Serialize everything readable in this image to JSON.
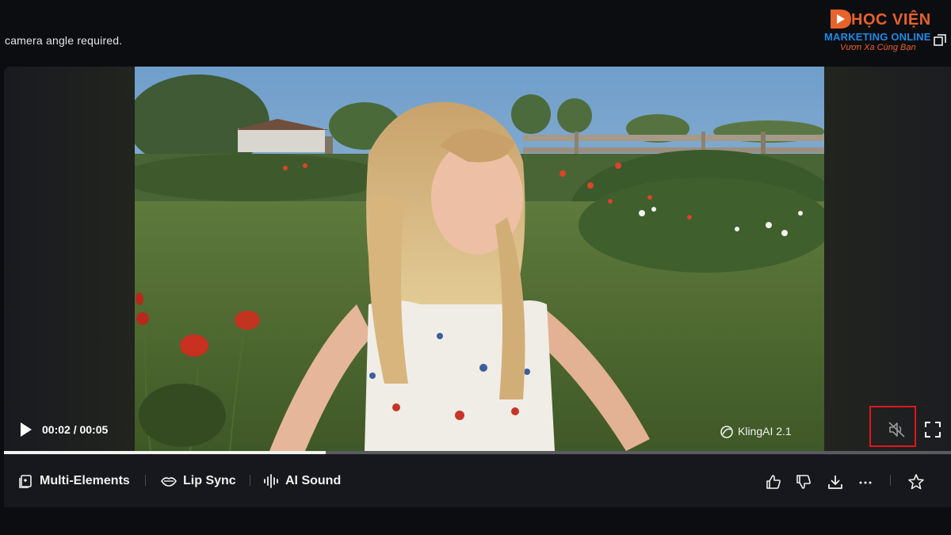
{
  "header": {
    "caption": "camera angle required."
  },
  "brand": {
    "line1": "HỌC VIỆN",
    "line2": "MARKETING ONLINE",
    "line3": "Vươn Xa Cùng Bạn",
    "color_primary": "#e8622c",
    "color_secondary": "#1f8be6"
  },
  "player": {
    "time_display": "00:02 / 00:05",
    "current": "00:02",
    "duration": "00:05",
    "progress_fraction": 0.34,
    "watermark": "KlingAI 2.1",
    "muted": true,
    "icons": [
      "play-icon",
      "volume-muted-icon",
      "fullscreen-icon",
      "window-icon"
    ],
    "highlight_color": "#e2151c"
  },
  "toolbar": {
    "tools": [
      {
        "label": "Multi-Elements",
        "icon": "multi-elements-icon"
      },
      {
        "label": "Lip Sync",
        "icon": "lip-sync-icon"
      },
      {
        "label": "AI Sound",
        "icon": "ai-sound-icon"
      }
    ],
    "actions": [
      "thumbs-up-icon",
      "thumbs-down-icon",
      "download-icon",
      "more-icon",
      "star-icon"
    ]
  }
}
